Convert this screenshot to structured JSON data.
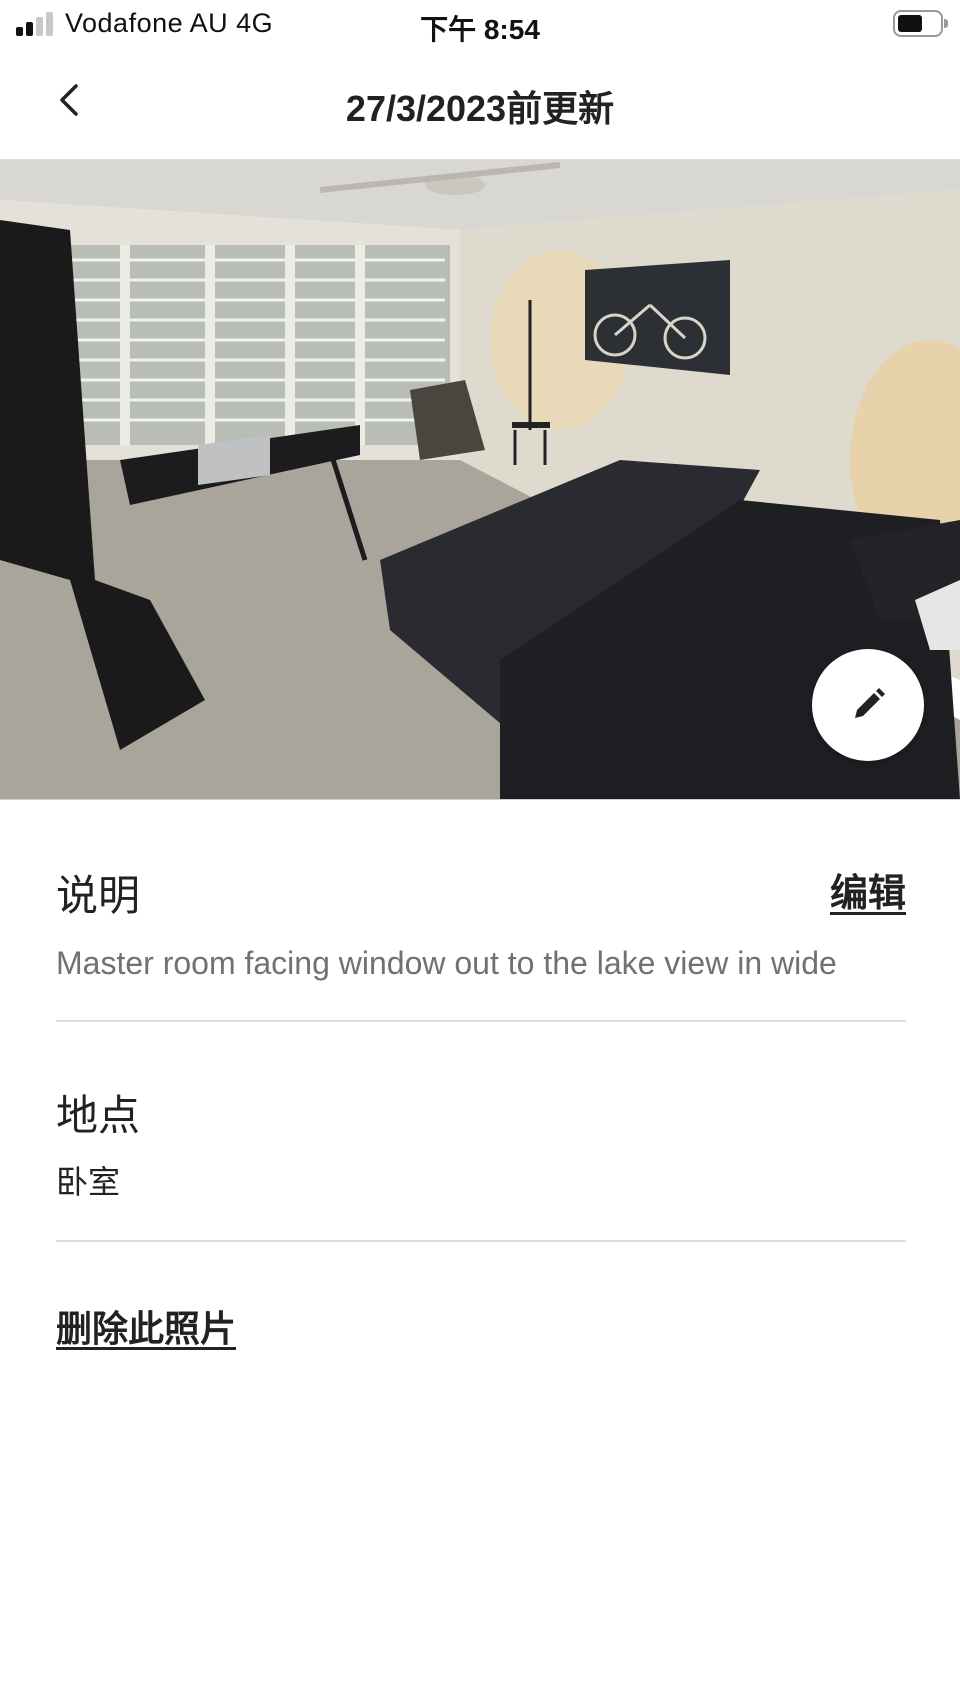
{
  "status_bar": {
    "carrier": "Vodafone AU   4G",
    "time": "下午 8:54"
  },
  "header": {
    "title": "27/3/2023前更新",
    "back_icon": "chevron-left-icon"
  },
  "photo": {
    "description": "bedroom",
    "edit_icon": "pencil-icon"
  },
  "description_section": {
    "title": "说明",
    "edit_label": "编辑",
    "text": "Master room facing window out to the lake view in wide"
  },
  "location_section": {
    "title": "地点",
    "value": "卧室"
  },
  "actions": {
    "delete_label": "删除此照片"
  }
}
